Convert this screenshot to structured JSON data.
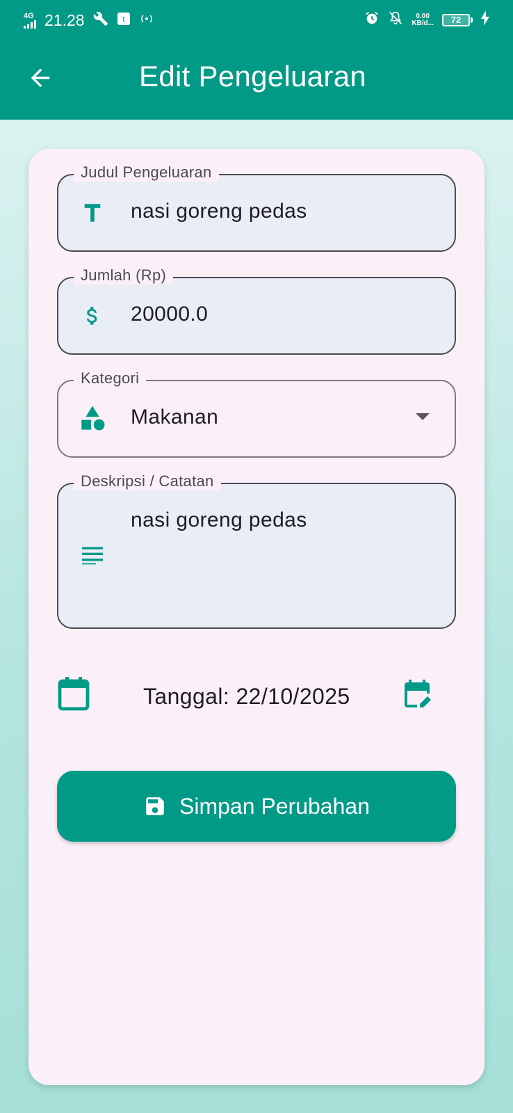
{
  "status_bar": {
    "network": "4G",
    "time": "21.28",
    "data_speed": "0.00",
    "data_unit": "KB/d...",
    "battery": "72"
  },
  "app_bar": {
    "title": "Edit Pengeluaran"
  },
  "form": {
    "title_field": {
      "label": "Judul Pengeluaran",
      "value": "nasi goreng pedas"
    },
    "amount_field": {
      "label": "Jumlah (Rp)",
      "value": "20000.0"
    },
    "category_field": {
      "label": "Kategori",
      "value": "Makanan"
    },
    "description_field": {
      "label": "Deskripsi / Catatan",
      "value": "nasi goreng pedas"
    },
    "date_text": "Tanggal: 22/10/2025",
    "save_label": "Simpan Perubahan"
  },
  "colors": {
    "primary": "#009a87",
    "card": "#fcf0f8",
    "field_fill": "#e9edf6"
  }
}
